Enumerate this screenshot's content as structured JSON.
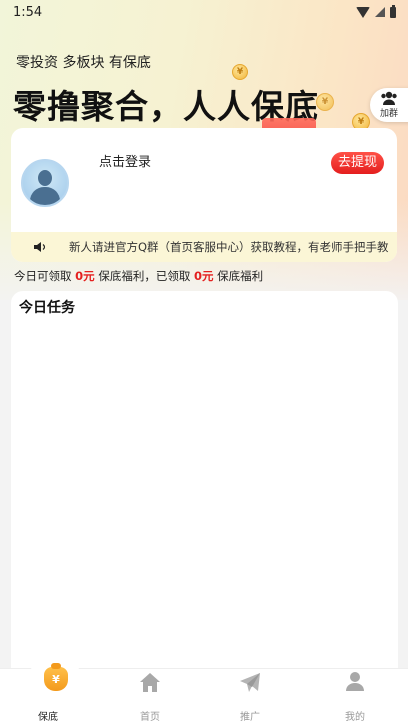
{
  "status_bar": {
    "time": "1:54",
    "icons": [
      "wifi-icon",
      "signal-icon",
      "battery-icon"
    ]
  },
  "hero": {
    "tagline": "零投资 多板块 有保底",
    "headline": "零撸聚合，人人保底",
    "coin_symbol": "¥"
  },
  "join_group": {
    "label": "加群",
    "icon": "group-icon"
  },
  "account_card": {
    "login_label": "点击登录",
    "withdraw_label": "去提现",
    "notice_text": "新人请进官方Q群（首页客服中心）获取教程，有老师手把手教"
  },
  "daily_summary": {
    "prefix": "今日可领取",
    "today_amount": "0元",
    "middle": "保底福利，已领取",
    "received_amount": "0元",
    "suffix": "保底福利"
  },
  "tasks": {
    "title": "今日任务"
  },
  "tabbar": {
    "tabs": [
      {
        "label": "保底",
        "icon": "money-bag-icon",
        "active": true
      },
      {
        "label": "首页",
        "icon": "home-icon",
        "active": false
      },
      {
        "label": "推广",
        "icon": "paper-plane-icon",
        "active": false
      },
      {
        "label": "我的",
        "icon": "user-icon",
        "active": false
      }
    ]
  },
  "colors": {
    "accent_red": "#e4201f",
    "notice_bg": "#fbf6d6",
    "coin_gold": "#f1b53a"
  }
}
